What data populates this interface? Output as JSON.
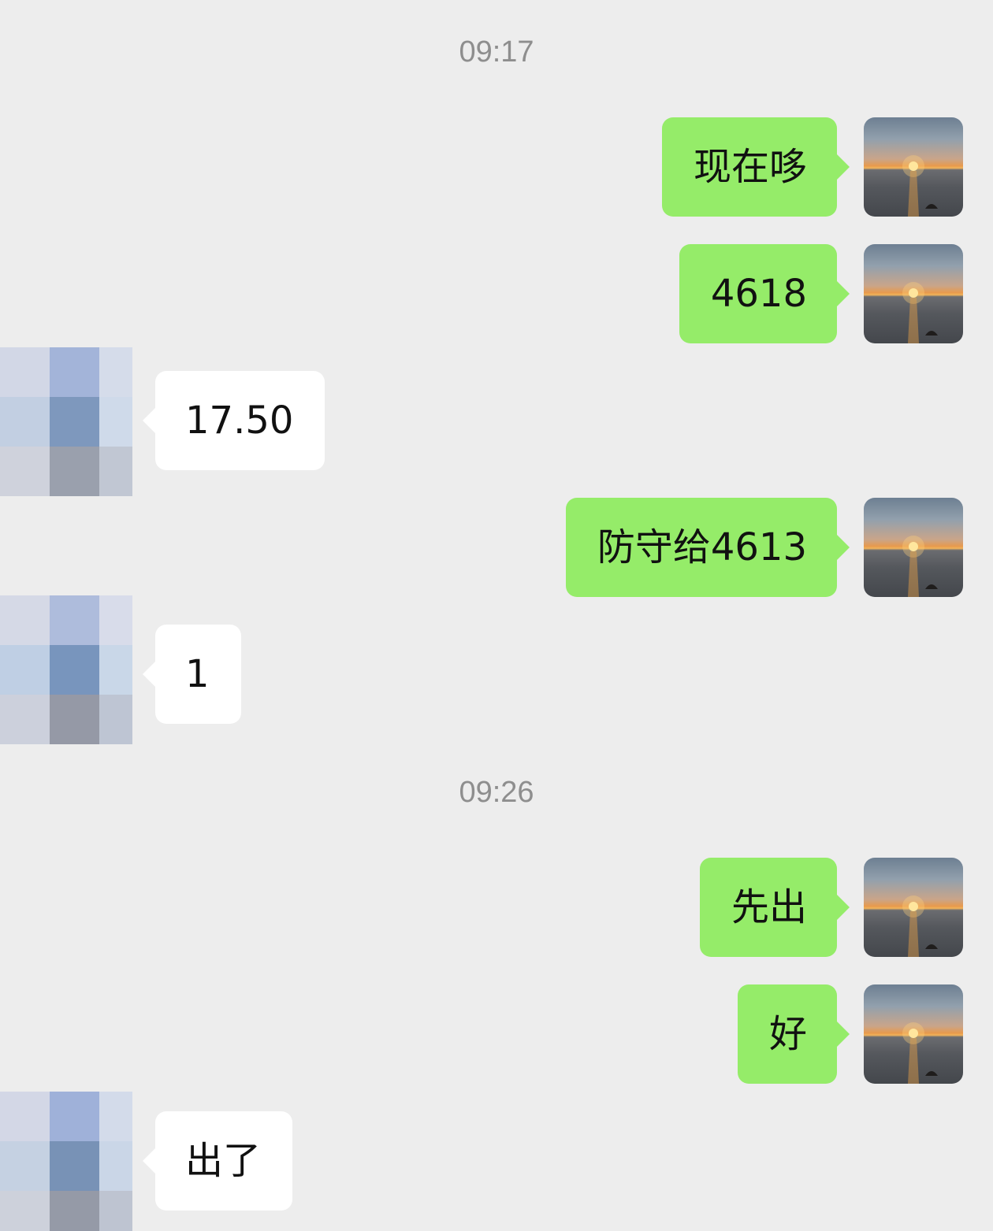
{
  "chat": {
    "timestamps": [
      "09:17",
      "09:26"
    ],
    "messages": [
      {
        "sender": "me",
        "text": "现在哆"
      },
      {
        "sender": "me",
        "text": "4618"
      },
      {
        "sender": "other",
        "text": "17.50"
      },
      {
        "sender": "me",
        "text": "防守给4613"
      },
      {
        "sender": "other",
        "text": "1"
      },
      {
        "sender": "me",
        "text": "先出"
      },
      {
        "sender": "me",
        "text": "好"
      },
      {
        "sender": "other",
        "text": "出了"
      }
    ]
  },
  "colors": {
    "background": "#ededed",
    "outgoing_bubble": "#95ec69",
    "incoming_bubble": "#ffffff",
    "timestamp_text": "#8e8e8e",
    "message_text": "#111111"
  },
  "icons": {
    "my_avatar": "sunset-photo-avatar",
    "other_avatar": "pixelated-avatar"
  }
}
